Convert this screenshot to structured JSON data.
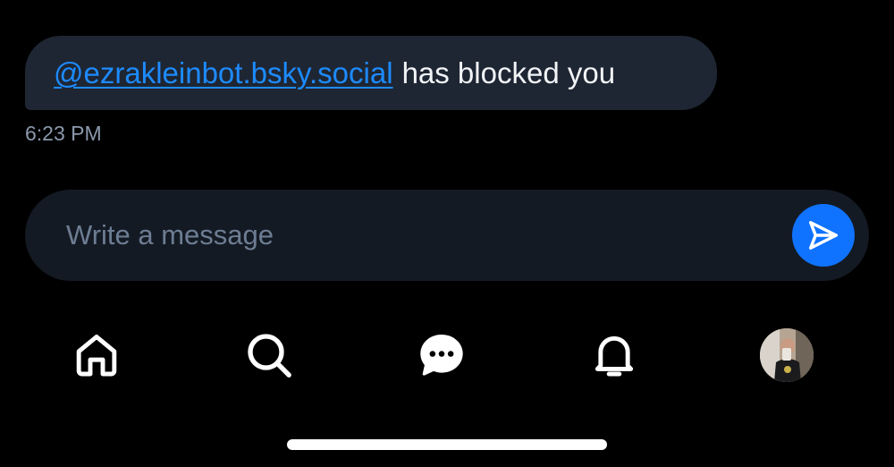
{
  "conversation": {
    "message": {
      "mention": "@ezrakleinbot.bsky.social",
      "text": "has blocked you",
      "timestamp": "6:23 PM"
    }
  },
  "composer": {
    "placeholder": "Write a message",
    "value": "",
    "send_icon": "paper-plane-icon"
  },
  "tabbar": {
    "items": [
      {
        "name": "home",
        "icon": "house-icon"
      },
      {
        "name": "search",
        "icon": "magnifier-icon"
      },
      {
        "name": "messages",
        "icon": "chat-bubble-icon"
      },
      {
        "name": "notifications",
        "icon": "bell-icon"
      },
      {
        "name": "profile",
        "icon": "avatar"
      }
    ]
  },
  "colors": {
    "background": "#000000",
    "bubble": "#1e2633",
    "composer": "#141a23",
    "accent": "#0f73ff",
    "link": "#1d8bff",
    "muted": "#8b98ab"
  }
}
